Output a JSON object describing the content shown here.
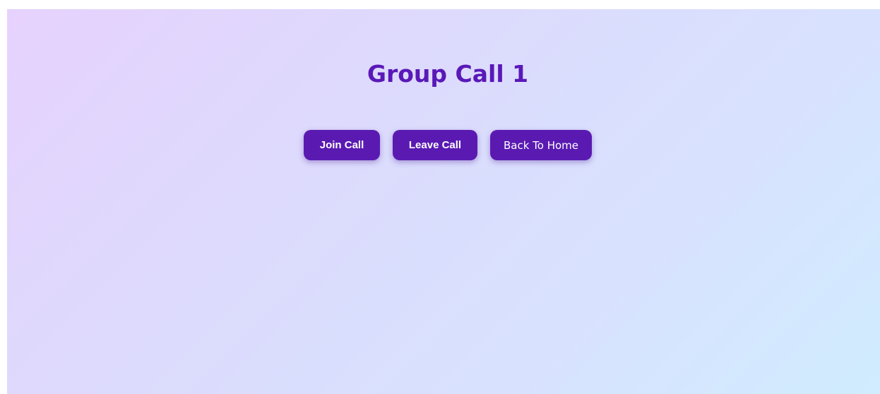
{
  "page": {
    "title": "Group Call 1"
  },
  "actions": {
    "join_label": "Join Call",
    "leave_label": "Leave Call",
    "home_label": "Back To Home"
  },
  "colors": {
    "accent": "#5a1ab2",
    "title": "#5a18b8",
    "background_start": "#e6d2fd",
    "background_end": "#d0ecfe"
  }
}
